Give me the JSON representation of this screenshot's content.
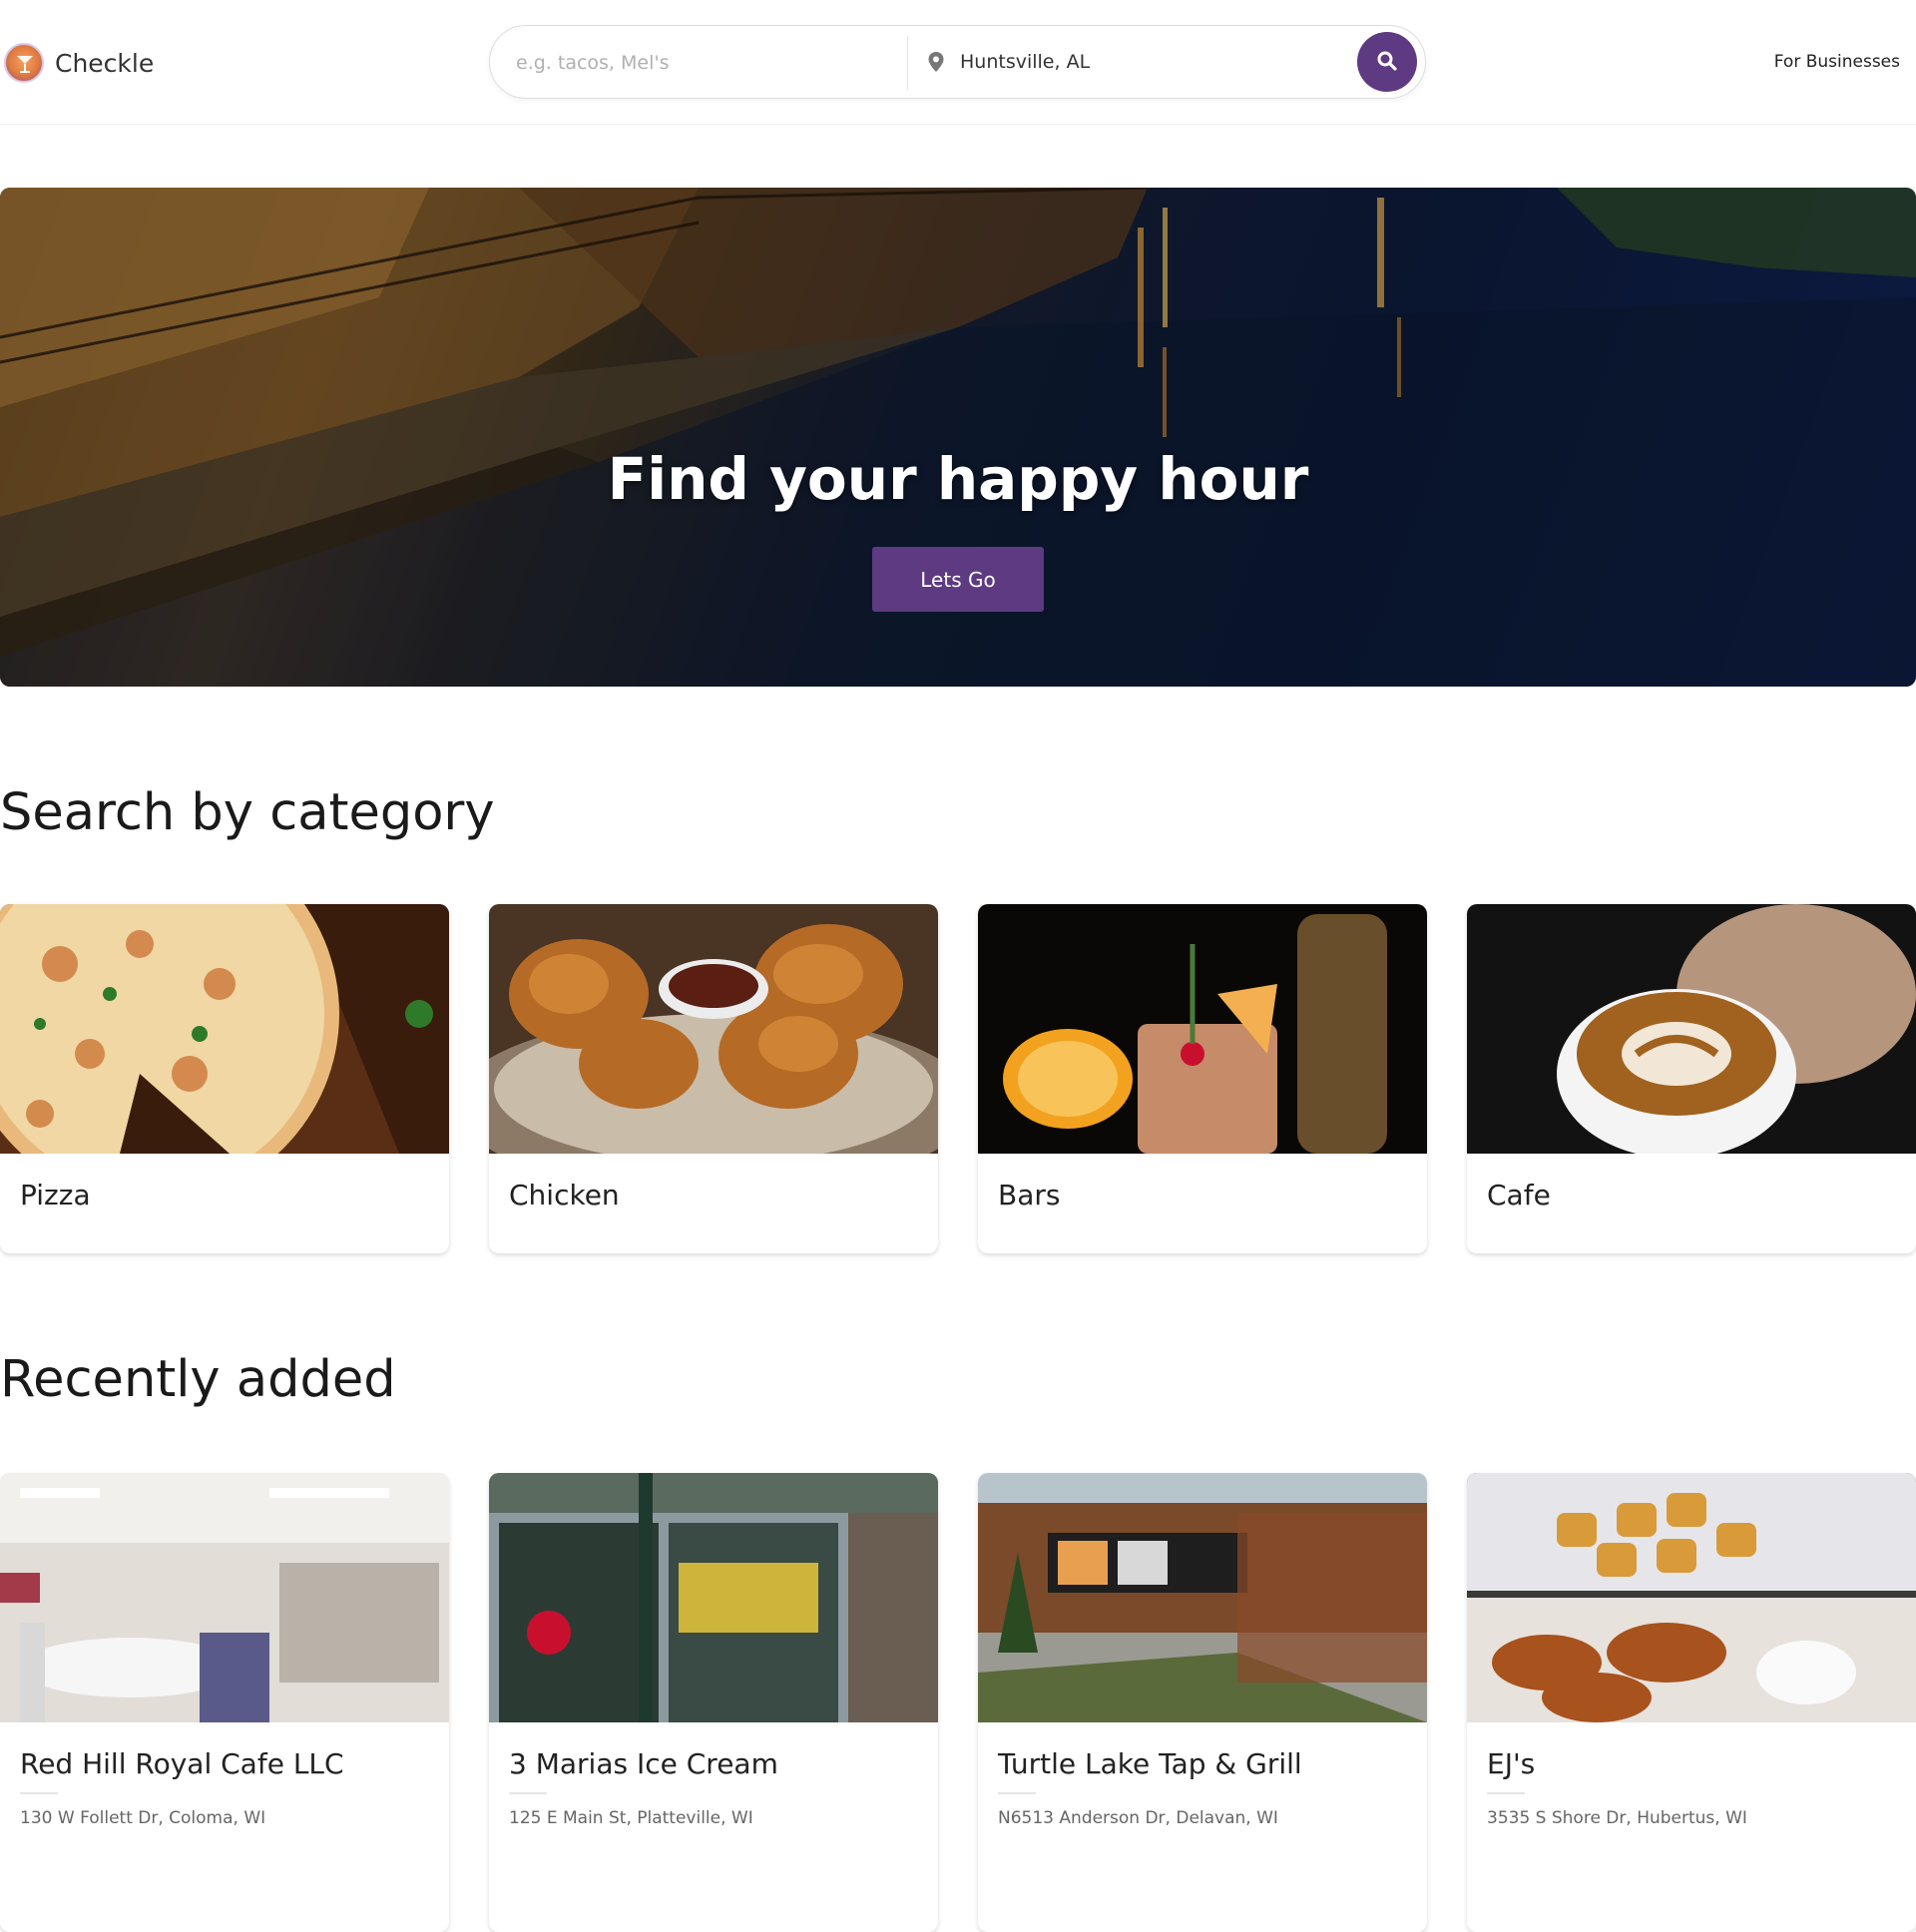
{
  "header": {
    "brand": "Checkle",
    "search_placeholder": "e.g. tacos, Mel's",
    "location": "Huntsville, AL",
    "for_businesses": "For Businesses"
  },
  "hero": {
    "title": "Find your happy hour",
    "button_label": "Lets Go"
  },
  "categories": {
    "title": "Search by category",
    "items": [
      {
        "label": "Pizza"
      },
      {
        "label": "Chicken"
      },
      {
        "label": "Bars"
      },
      {
        "label": "Cafe"
      }
    ]
  },
  "recent": {
    "title": "Recently added",
    "items": [
      {
        "name": "Red Hill Royal Cafe LLC",
        "address": "130 W Follett Dr, Coloma, WI"
      },
      {
        "name": "3 Marias Ice Cream",
        "address": "125 E Main St, Platteville, WI"
      },
      {
        "name": "Turtle Lake Tap & Grill",
        "address": "N6513 Anderson Dr, Delavan, WI"
      },
      {
        "name": "EJ's",
        "address": "3535 S Shore Dr, Hubertus, WI"
      }
    ]
  },
  "colors": {
    "accent": "#5d3a82",
    "text": "#222222"
  },
  "icons": [
    "checkle-logo-icon",
    "location-pin-icon",
    "search-icon"
  ]
}
